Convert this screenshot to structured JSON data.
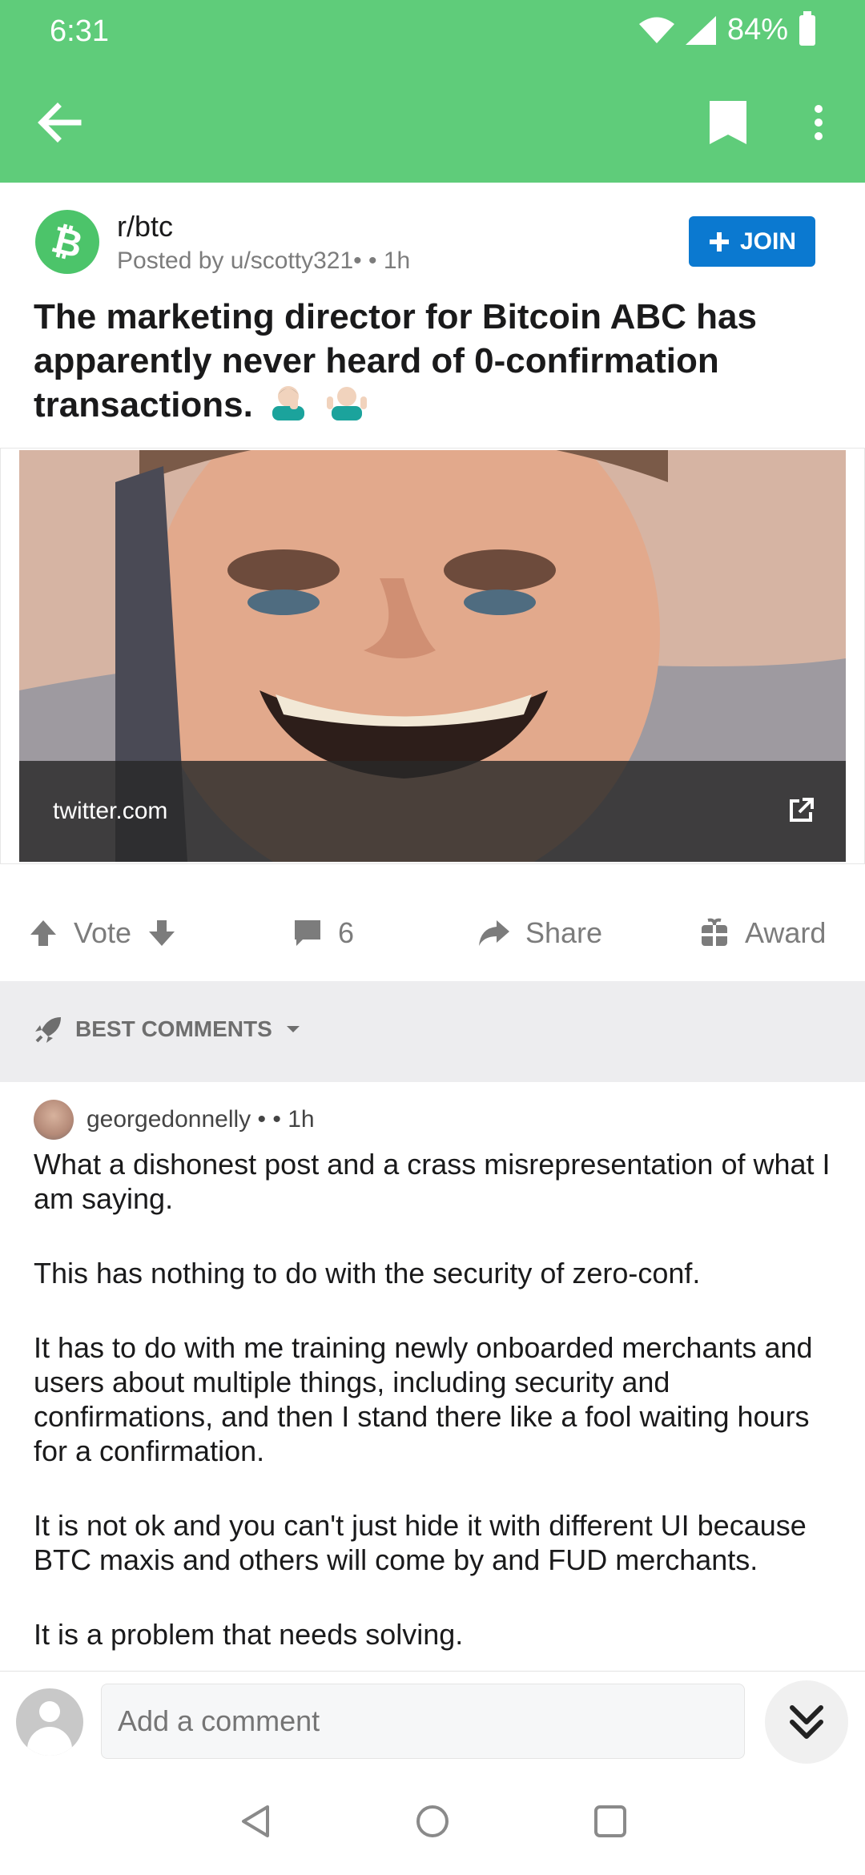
{
  "status_bar": {
    "time": "6:31",
    "battery": "84%"
  },
  "post": {
    "subreddit": "r/btc",
    "posted_by": "Posted by u/scotty321•",
    "age": "• 1h",
    "join_label": "JOIN",
    "title": "The marketing director for Bitcoin ABC has apparently never heard of 0-confirmation transactions."
  },
  "link_preview": {
    "domain": "twitter.com"
  },
  "actions": {
    "vote_label": "Vote",
    "comment_count": "6",
    "share_label": "Share",
    "award_label": "Award"
  },
  "sort": {
    "label": "BEST COMMENTS"
  },
  "comment": {
    "author": "georgedonnelly",
    "dot": "•",
    "age": "• 1h",
    "paragraphs": [
      "What a dishonest post and a crass misrepresentation of what I am saying.",
      "This has nothing to do with the security of zero-conf.",
      "It has to do with me training newly onboarded merchants and users about multiple things, including security and confirmations, and then I stand there like a fool waiting hours for a confirmation.",
      "It is not ok and you can't just hide it with different UI because BTC maxis and others will come by and FUD merchants.",
      "It is a problem that needs solving."
    ]
  },
  "comment_input": {
    "placeholder": "Add a comment"
  },
  "colors": {
    "header_green": "#5fcc7a",
    "join_blue": "#0b79d0"
  }
}
